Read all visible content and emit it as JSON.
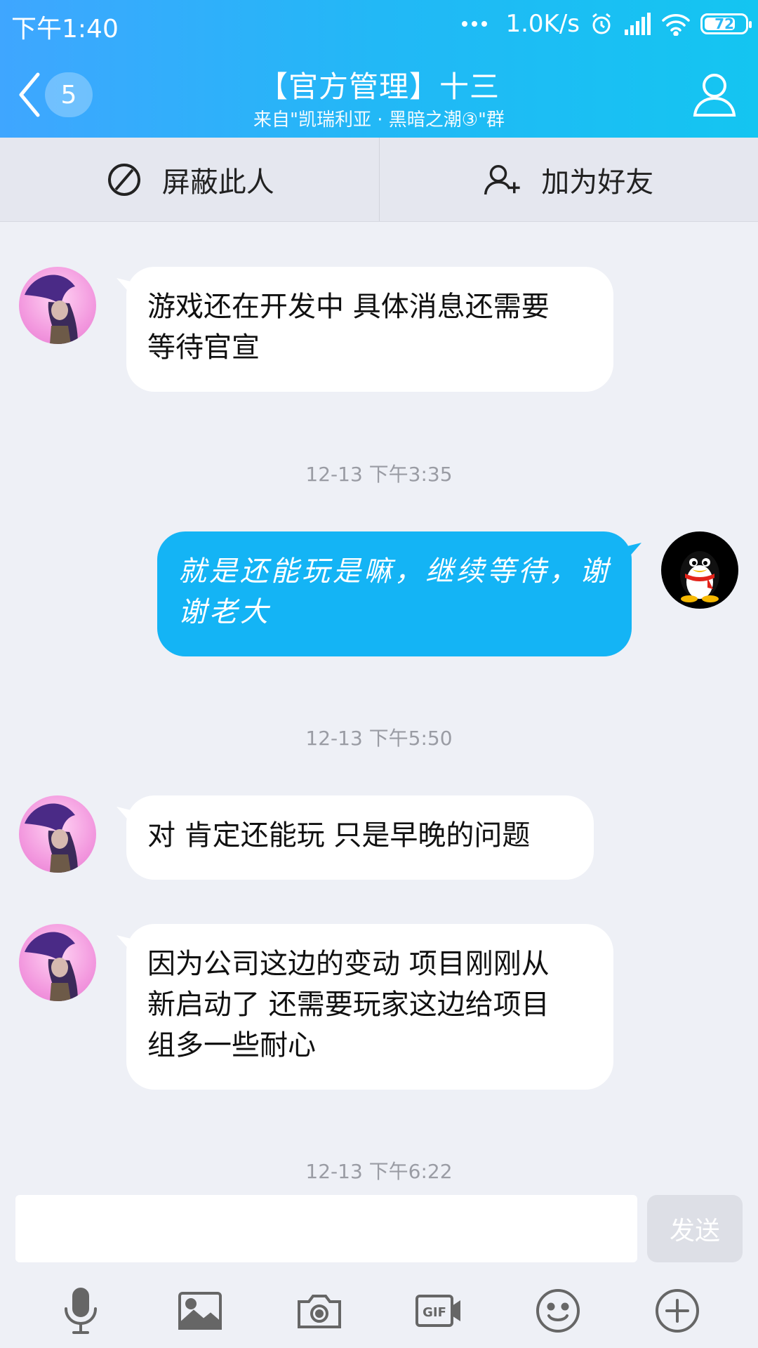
{
  "status_bar": {
    "time": "下午1:40",
    "network_speed": "1.0K/s",
    "battery": "72"
  },
  "header": {
    "unread_count": "5",
    "title": "【官方管理】十三",
    "subtitle": "来自\"凯瑞利亚 · 黑暗之潮③\"群"
  },
  "actions": {
    "block_label": "屏蔽此人",
    "add_friend_label": "加为好友"
  },
  "messages": [
    {
      "side": "left",
      "text_line1": "游戏还在开发中 具体消息还需要",
      "text_line2": "等待官宣"
    },
    {
      "timestamp": "12-13 下午3:35"
    },
    {
      "side": "right",
      "text_line1": "就是还能玩是嘛，继续等待，谢",
      "text_line2": "谢老大"
    },
    {
      "timestamp": "12-13 下午5:50"
    },
    {
      "side": "left",
      "text_line1": "对 肯定还能玩 只是早晚的问题"
    },
    {
      "side": "left",
      "text_line1": "因为公司这边的变动 项目刚刚从",
      "text_line2": "新启动了 还需要玩家这边给项目",
      "text_line3": "组多一些耐心"
    },
    {
      "timestamp": "12-13 下午6:22"
    }
  ],
  "composer": {
    "input_value": "",
    "send_label": "发送"
  },
  "toolbar": [
    "microphone-icon",
    "image-icon",
    "camera-icon",
    "gif-icon",
    "emoji-icon",
    "plus-icon"
  ],
  "colors": {
    "header_gradient_start": "#3fa6ff",
    "header_gradient_end": "#14c5f1",
    "outgoing_bubble": "#14b4f5",
    "incoming_bubble": "#ffffff",
    "background": "#eef0f6"
  }
}
